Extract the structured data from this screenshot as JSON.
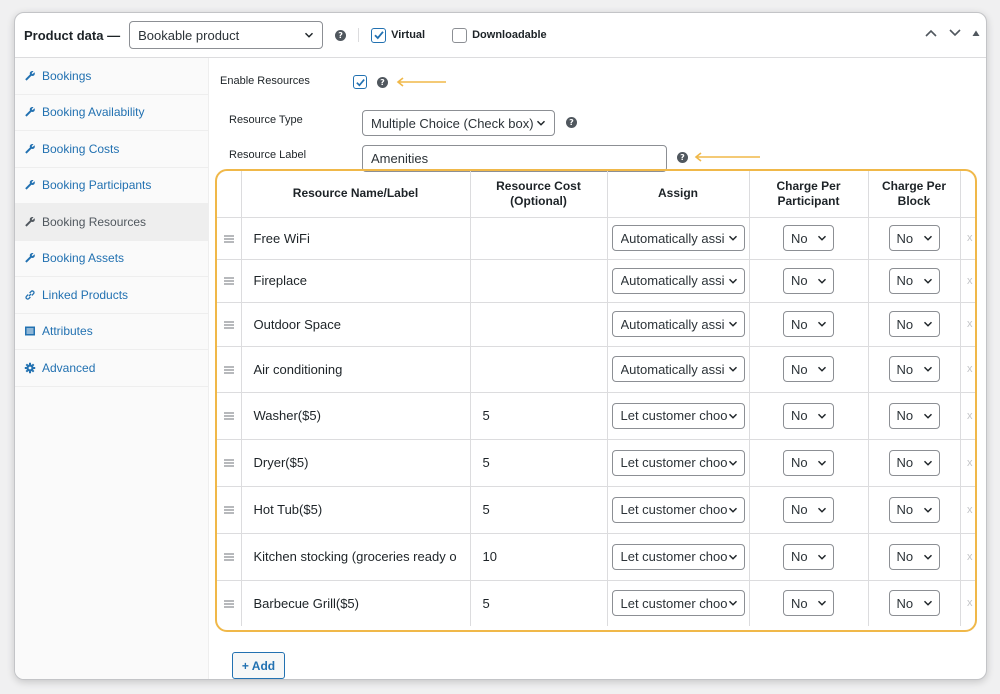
{
  "header": {
    "title": "Product data —",
    "product_type": "Bookable product",
    "virtual_label": "Virtual",
    "virtual_checked": true,
    "downloadable_label": "Downloadable",
    "downloadable_checked": false
  },
  "sidebar": {
    "items": [
      {
        "label": "Bookings",
        "icon": "wrench-icon"
      },
      {
        "label": "Booking Availability",
        "icon": "wrench-icon"
      },
      {
        "label": "Booking Costs",
        "icon": "wrench-icon"
      },
      {
        "label": "Booking Participants",
        "icon": "wrench-icon"
      },
      {
        "label": "Booking Resources",
        "icon": "wrench-icon",
        "active": true
      },
      {
        "label": "Booking Assets",
        "icon": "wrench-icon"
      },
      {
        "label": "Linked Products",
        "icon": "link-icon"
      },
      {
        "label": "Attributes",
        "icon": "list-icon"
      },
      {
        "label": "Advanced",
        "icon": "gear-icon"
      }
    ]
  },
  "form": {
    "enable_resources_label": "Enable Resources",
    "enable_resources_checked": true,
    "resource_type_label": "Resource Type",
    "resource_type_value": "Multiple Choice (Check box)",
    "resource_label_label": "Resource Label",
    "resource_label_value": "Amenities"
  },
  "table": {
    "headers": {
      "name": "Resource Name/Label",
      "cost": "Resource Cost (Optional)",
      "assign": "Assign",
      "participant": "Charge Per Participant",
      "block": "Charge Per Block"
    },
    "rows": [
      {
        "name": "Free WiFi",
        "cost": "",
        "assign": "Automatically assi",
        "participant": "No",
        "block": "No"
      },
      {
        "name": "Fireplace",
        "cost": "",
        "assign": "Automatically assi",
        "participant": "No",
        "block": "No"
      },
      {
        "name": "Outdoor Space",
        "cost": "",
        "assign": "Automatically assi",
        "participant": "No",
        "block": "No"
      },
      {
        "name": "Air conditioning",
        "cost": "",
        "assign": "Automatically assi",
        "participant": "No",
        "block": "No"
      },
      {
        "name": "Washer($5)",
        "cost": "5",
        "assign": "Let customer choo",
        "participant": "No",
        "block": "No"
      },
      {
        "name": "Dryer($5)",
        "cost": "5",
        "assign": "Let customer choo",
        "participant": "No",
        "block": "No"
      },
      {
        "name": "Hot Tub($5)",
        "cost": "5",
        "assign": "Let customer choo",
        "participant": "No",
        "block": "No"
      },
      {
        "name": "Kitchen stocking (groceries ready o",
        "cost": "10",
        "assign": "Let customer choo",
        "participant": "No",
        "block": "No"
      },
      {
        "name": "Barbecue Grill($5)",
        "cost": "5",
        "assign": "Let customer choo",
        "participant": "No",
        "block": "No"
      }
    ],
    "remove_symbol": "x"
  },
  "add_button": "+ Add",
  "colors": {
    "link": "#2271b1",
    "highlight": "#f0b849"
  }
}
